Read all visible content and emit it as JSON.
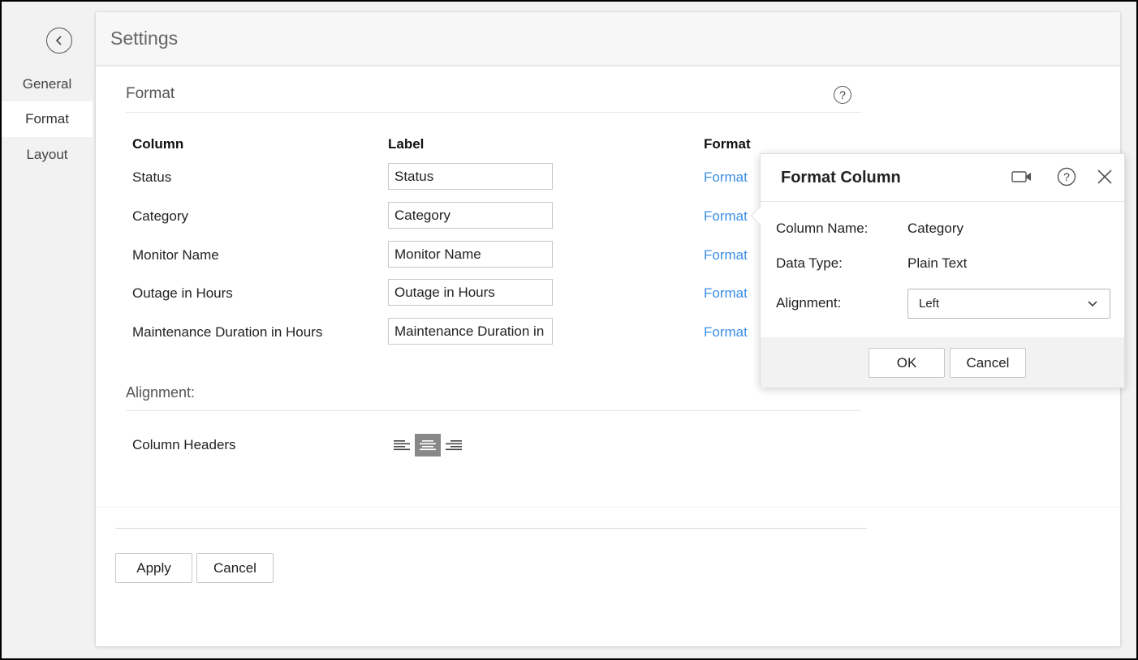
{
  "sidebar": {
    "back_icon": "chevron-left-icon",
    "items": [
      {
        "label": "General",
        "active": false
      },
      {
        "label": "Format",
        "active": true
      },
      {
        "label": "Layout",
        "active": false
      }
    ]
  },
  "header": {
    "title": "Settings"
  },
  "format_section": {
    "title": "Format",
    "help_icon": "question-circle-icon",
    "columns": {
      "column": "Column",
      "label": "Label",
      "format": "Format"
    },
    "rows": [
      {
        "column": "Status",
        "label": "Status",
        "format_link": "Format"
      },
      {
        "column": "Category",
        "label": "Category",
        "format_link": "Format"
      },
      {
        "column": "Monitor Name",
        "label": "Monitor Name",
        "format_link": "Format"
      },
      {
        "column": "Outage in Hours",
        "label": "Outage in Hours",
        "format_link": "Format"
      },
      {
        "column": "Maintenance Duration in Hours",
        "label": "Maintenance Duration in Hours",
        "format_link": "Format"
      }
    ]
  },
  "alignment_section": {
    "title": "Alignment:",
    "column_headers_label": "Column Headers",
    "options": [
      "align-left-icon",
      "align-center-icon",
      "align-right-icon"
    ],
    "selected": "center"
  },
  "footer": {
    "apply_label": "Apply",
    "cancel_label": "Cancel"
  },
  "popup": {
    "title": "Format Column",
    "icons": [
      "video-icon",
      "question-circle-icon",
      "close-icon"
    ],
    "column_name_label": "Column Name:",
    "column_name_value": "Category",
    "data_type_label": "Data Type:",
    "data_type_value": "Plain Text",
    "alignment_label": "Alignment:",
    "alignment_value": "Left",
    "ok_label": "OK",
    "cancel_label": "Cancel"
  },
  "colors": {
    "link": "#3a8ee6",
    "active_align": "#888888"
  }
}
